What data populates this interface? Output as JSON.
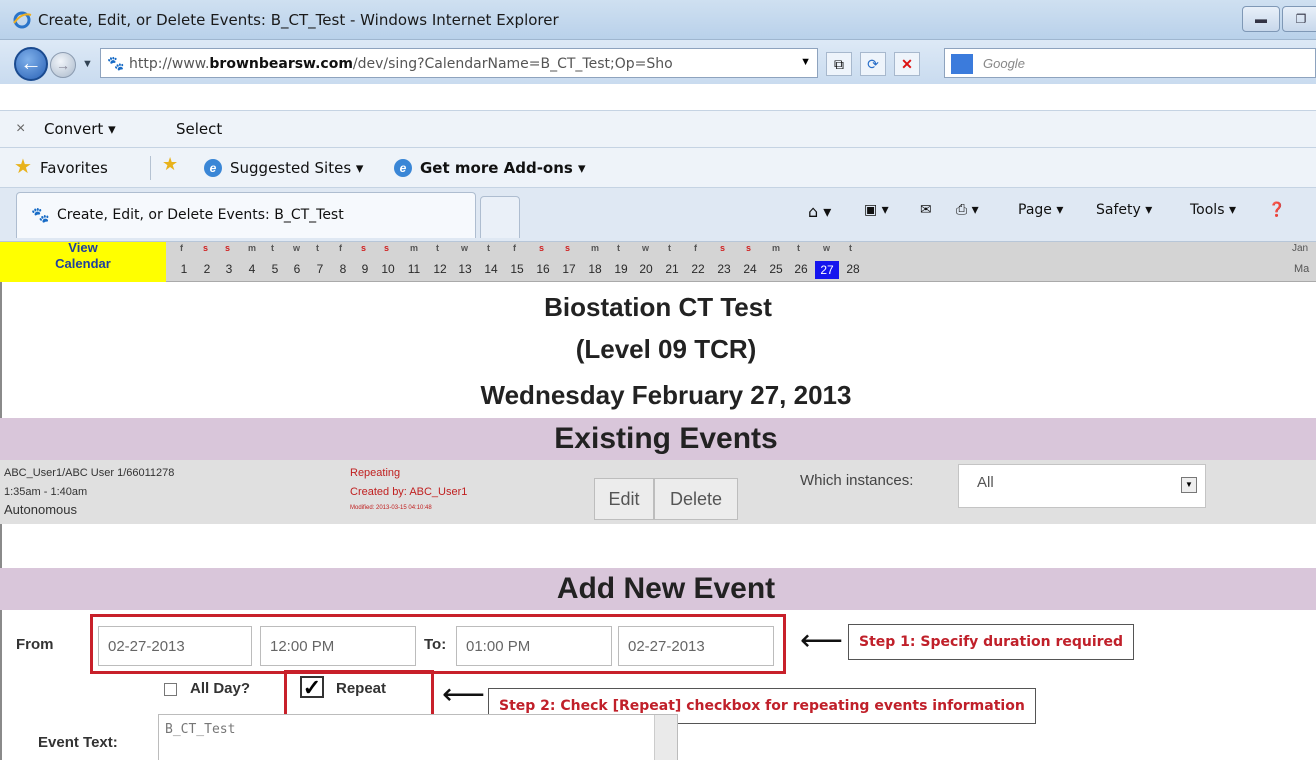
{
  "window": {
    "title": "Create, Edit, or Delete Events: B_CT_Test - Windows Internet Explorer"
  },
  "address": {
    "url_prefix": "http://www.",
    "url_domain": "brownbearsw.com",
    "url_rest": "/dev/sing?CalendarName=B_CT_Test;Op=Sho"
  },
  "search": {
    "placeholder": "Google"
  },
  "command_bar": {
    "convert": "Convert ▾",
    "select": "Select"
  },
  "favorites_bar": {
    "favorites": "Favorites",
    "suggested": "Suggested Sites ▾",
    "addons": "Get more Add-ons ▾"
  },
  "tab": {
    "label": "Create, Edit, or Delete Events: B_CT_Test"
  },
  "tools": {
    "page": "Page ▾",
    "safety": "Safety ▾",
    "tools": "Tools ▾"
  },
  "calendar_strip": {
    "view_line1": "View",
    "view_line2": "Calendar",
    "days": [
      {
        "dow": "f",
        "num": "1"
      },
      {
        "dow": "s",
        "num": "2"
      },
      {
        "dow": "s",
        "num": "3"
      },
      {
        "dow": "m",
        "num": "4"
      },
      {
        "dow": "t",
        "num": "5"
      },
      {
        "dow": "w",
        "num": "6"
      },
      {
        "dow": "t",
        "num": "7"
      },
      {
        "dow": "f",
        "num": "8"
      },
      {
        "dow": "s",
        "num": "9"
      },
      {
        "dow": "s",
        "num": "10"
      },
      {
        "dow": "m",
        "num": "11"
      },
      {
        "dow": "t",
        "num": "12"
      },
      {
        "dow": "w",
        "num": "13"
      },
      {
        "dow": "t",
        "num": "14"
      },
      {
        "dow": "f",
        "num": "15"
      },
      {
        "dow": "s",
        "num": "16"
      },
      {
        "dow": "s",
        "num": "17"
      },
      {
        "dow": "m",
        "num": "18"
      },
      {
        "dow": "t",
        "num": "19"
      },
      {
        "dow": "w",
        "num": "20"
      },
      {
        "dow": "t",
        "num": "21"
      },
      {
        "dow": "f",
        "num": "22"
      },
      {
        "dow": "s",
        "num": "23"
      },
      {
        "dow": "s",
        "num": "24"
      },
      {
        "dow": "m",
        "num": "25"
      },
      {
        "dow": "t",
        "num": "26"
      },
      {
        "dow": "w",
        "num": "27"
      },
      {
        "dow": "t",
        "num": "28"
      }
    ],
    "selected_day": "27",
    "prev_month": "Jan",
    "next_month": "Ma"
  },
  "page": {
    "title": "Biostation CT Test",
    "subtitle": "(Level 09 TCR)",
    "date": "Wednesday February 27, 2013"
  },
  "existing_events": {
    "heading": "Existing Events",
    "event": {
      "user": "ABC_User1/ABC User 1/66011278",
      "time": "1:35am - 1:40am",
      "type": "Autonomous",
      "repeating": "Repeating",
      "created_by": "Created by: ABC_User1",
      "modified": "Modified: 2013-03-15 04:10:48",
      "edit_label": "Edit",
      "delete_label": "Delete",
      "which_label": "Which instances:",
      "which_value": "All"
    }
  },
  "add_event": {
    "heading": "Add New Event",
    "from_label": "From",
    "from_date": "02-27-2013",
    "from_time": "12:00 PM",
    "to_label": "To:",
    "to_time": "01:00 PM",
    "to_date": "02-27-2013",
    "all_day_label": "All Day?",
    "repeat_label": "Repeat",
    "event_text_label": "Event Text:",
    "event_text_value": "B_CT_Test"
  },
  "annotations": {
    "step1": "Step 1: Specify duration required",
    "step2": "Step 2: Check [Repeat] checkbox for repeating events information"
  },
  "colors": {
    "band": "#d9c6da",
    "highlight_yellow": "#ffff00",
    "today": "#1515ee",
    "callout_red": "#c8202a"
  }
}
